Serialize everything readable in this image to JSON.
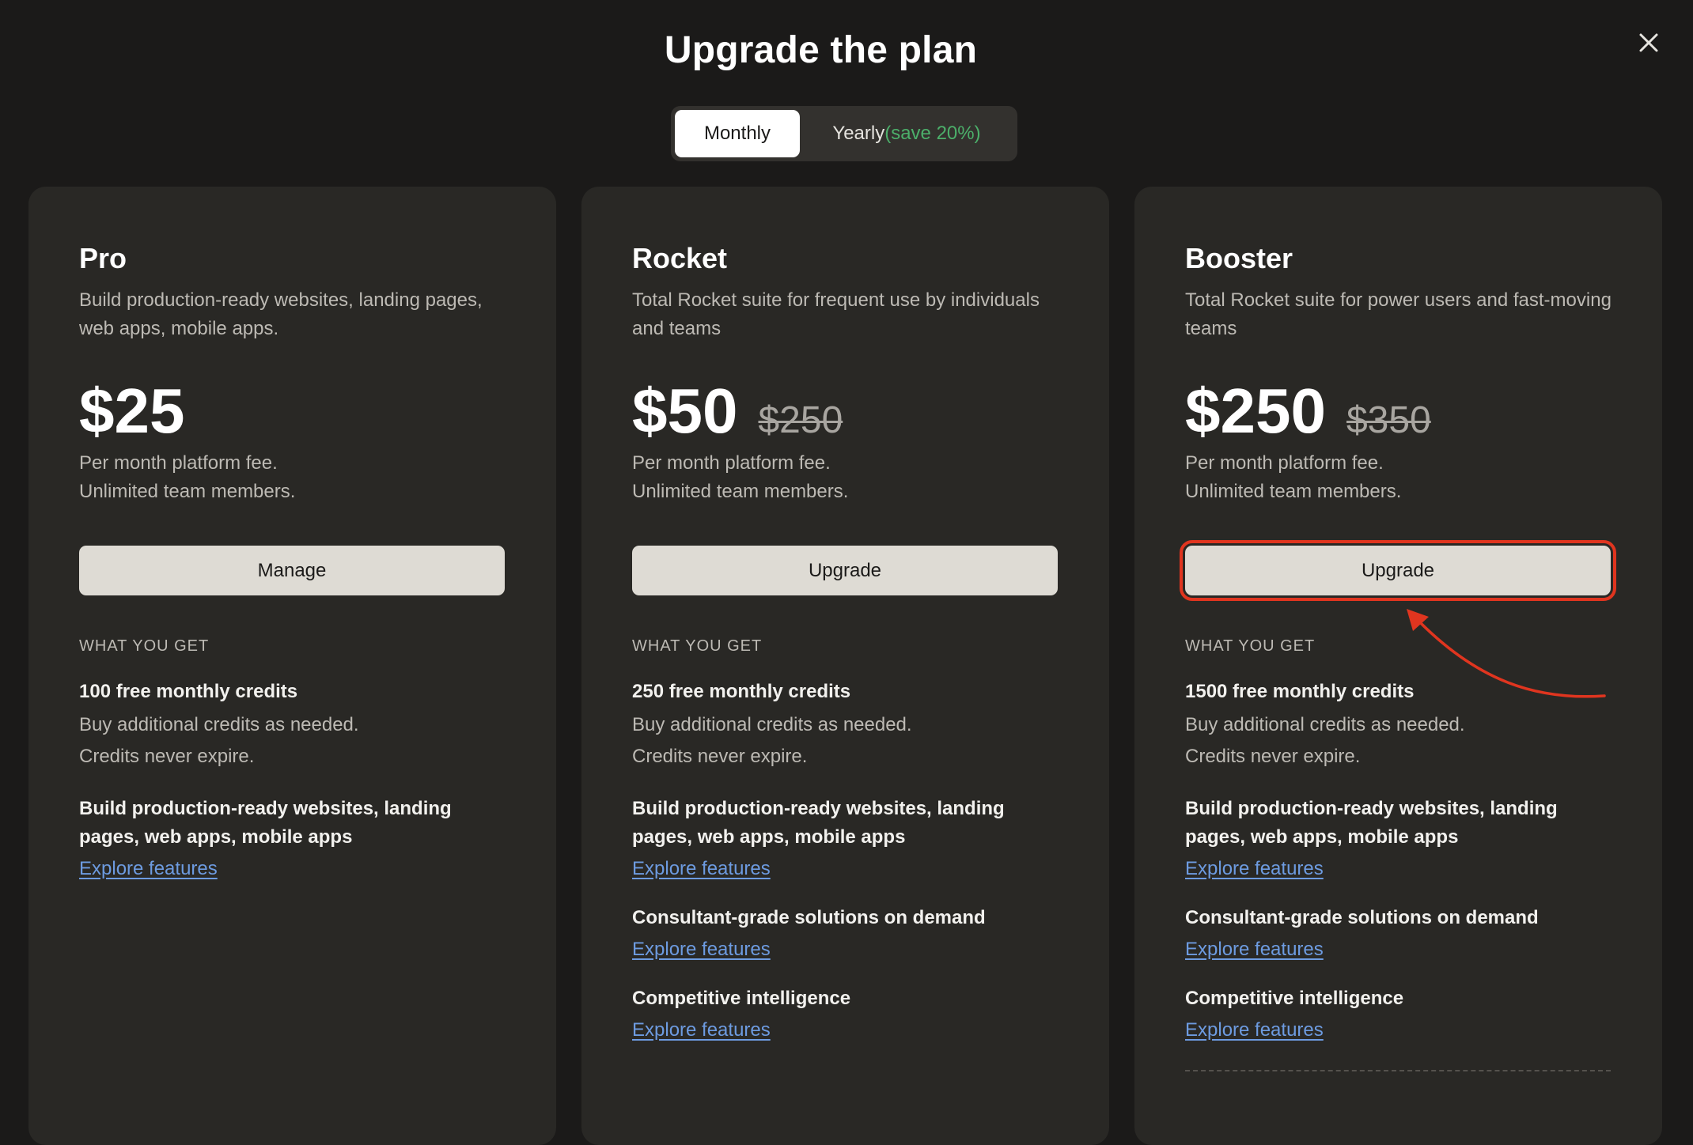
{
  "dialog": {
    "title": "Upgrade the plan",
    "close_icon": "close-icon"
  },
  "billing_toggle": {
    "monthly_label": "Monthly",
    "yearly_label": "Yearly",
    "yearly_save": "(save 20%)",
    "selected": "Monthly"
  },
  "plans": [
    {
      "name": "Pro",
      "description": "Build production-ready websites, landing pages, web apps, mobile apps.",
      "price": "$25",
      "old_price": "",
      "fee_line1": "Per month platform fee.",
      "fee_line2": "Unlimited team members.",
      "cta_label": "Manage",
      "wyg_label": "WHAT YOU GET",
      "credits": "100 free monthly credits",
      "credits_note1": "Buy additional credits as needed.",
      "credits_note2": "Credits never expire.",
      "features": [
        {
          "title": "Build production-ready websites, landing pages, web apps, mobile apps",
          "link": "Explore features"
        }
      ]
    },
    {
      "name": "Rocket",
      "description": "Total Rocket suite for frequent use by individuals and teams",
      "price": "$50",
      "old_price": "$250",
      "fee_line1": "Per month platform fee.",
      "fee_line2": "Unlimited team members.",
      "cta_label": "Upgrade",
      "wyg_label": "WHAT YOU GET",
      "credits": "250 free monthly credits",
      "credits_note1": "Buy additional credits as needed.",
      "credits_note2": "Credits never expire.",
      "features": [
        {
          "title": "Build production-ready websites, landing pages, web apps, mobile apps",
          "link": "Explore features"
        },
        {
          "title": "Consultant-grade solutions on demand",
          "link": "Explore features"
        },
        {
          "title": "Competitive intelligence",
          "link": "Explore features"
        }
      ]
    },
    {
      "name": "Booster",
      "description": "Total Rocket suite for power users and fast-moving teams",
      "price": "$250",
      "old_price": "$350",
      "fee_line1": "Per month platform fee.",
      "fee_line2": "Unlimited team members.",
      "cta_label": "Upgrade",
      "wyg_label": "WHAT YOU GET",
      "credits": "1500 free monthly credits",
      "credits_note1": "Buy additional credits as needed.",
      "credits_note2": "Credits never expire.",
      "features": [
        {
          "title": "Build production-ready websites, landing pages, web apps, mobile apps",
          "link": "Explore features"
        },
        {
          "title": "Consultant-grade solutions on demand",
          "link": "Explore features"
        },
        {
          "title": "Competitive intelligence",
          "link": "Explore features"
        }
      ]
    }
  ],
  "colors": {
    "background": "#1b1a19",
    "card": "#292825",
    "button": "#dedbd4",
    "link": "#6d9be0",
    "save_green": "#4caf6a",
    "highlight": "#e0351f"
  }
}
